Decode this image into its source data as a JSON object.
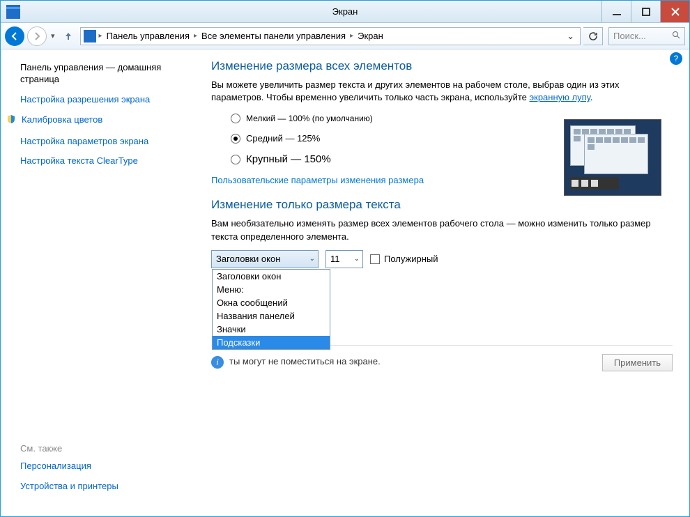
{
  "titlebar": {
    "title": "Экран"
  },
  "nav": {
    "breadcrumb": [
      "Панель управления",
      "Все элементы панели управления",
      "Экран"
    ],
    "search_placeholder": "Поиск..."
  },
  "sidebar": {
    "heading": "Панель управления — домашняя страница",
    "links": {
      "resolution": "Настройка разрешения экрана",
      "calibration": "Калибровка цветов",
      "params": "Настройка параметров экрана",
      "cleartype": "Настройка текста ClearType"
    },
    "see_also": "См. также",
    "bottom": {
      "personalization": "Персонализация",
      "devices": "Устройства и принтеры"
    }
  },
  "main": {
    "heading1": "Изменение размера всех элементов",
    "desc1_before": "Вы можете увеличить размер текста и других элементов на рабочем столе, выбрав один из этих параметров. Чтобы временно увеличить только часть экрана, используйте ",
    "desc1_link": "экранную лупу",
    "desc1_after": ".",
    "radio_small": "Мелкий — 100% (по умолчанию)",
    "radio_medium": "Средний — 125%",
    "radio_large": "Крупный — 150%",
    "custom_link": "Пользовательские параметры изменения размера",
    "heading2": "Изменение только размера текста",
    "desc2": "Вам необязательно изменять размер всех элементов рабочего стола — можно изменить только размер текста определенного элемента.",
    "combo_label": "Заголовки окон",
    "fontsize": "11",
    "bold": "Полужирный",
    "dropdown": [
      "Заголовки окон",
      "Меню:",
      "Окна сообщений",
      "Названия панелей",
      "Значки",
      "Подсказки"
    ],
    "note_partial": "ты могут не поместиться на экране.",
    "apply": "Применить"
  }
}
